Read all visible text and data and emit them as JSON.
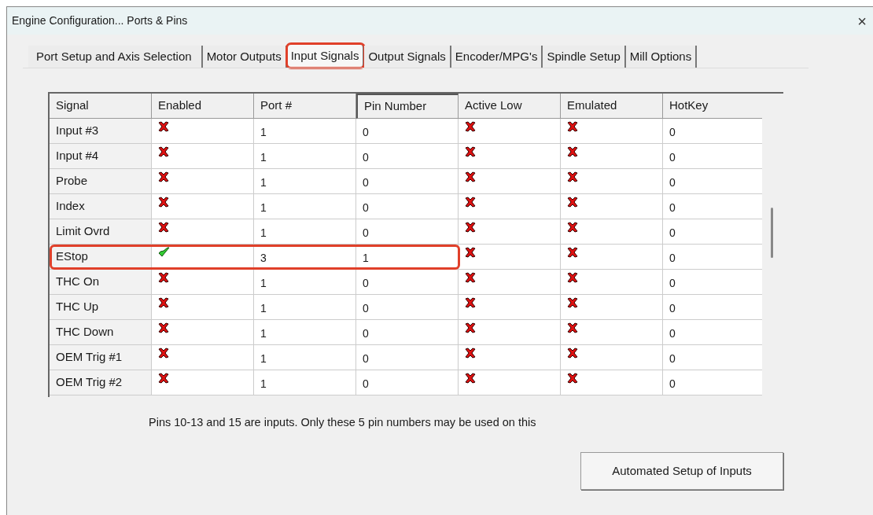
{
  "window": {
    "title": "Engine Configuration... Ports & Pins",
    "close": "×"
  },
  "tabs": [
    {
      "label": "Port Setup and Axis Selection",
      "selected": false,
      "annotated": false
    },
    {
      "label": "Motor Outputs",
      "selected": false,
      "annotated": false
    },
    {
      "label": "Input Signals",
      "selected": true,
      "annotated": true
    },
    {
      "label": "Output Signals",
      "selected": false,
      "annotated": false
    },
    {
      "label": "Encoder/MPG's",
      "selected": false,
      "annotated": false
    },
    {
      "label": "Spindle Setup",
      "selected": false,
      "annotated": false
    },
    {
      "label": "Mill Options",
      "selected": false,
      "annotated": false
    }
  ],
  "table": {
    "columns": [
      "Signal",
      "Enabled",
      "Port #",
      "Pin Number",
      "Active Low",
      "Emulated",
      "HotKey"
    ],
    "rows": [
      {
        "signal": "Input #3",
        "enabled": false,
        "port": "1",
        "pin": "0",
        "active_low": false,
        "emulated": false,
        "hotkey": "0",
        "annotated": false
      },
      {
        "signal": "Input #4",
        "enabled": false,
        "port": "1",
        "pin": "0",
        "active_low": false,
        "emulated": false,
        "hotkey": "0",
        "annotated": false
      },
      {
        "signal": "Probe",
        "enabled": false,
        "port": "1",
        "pin": "0",
        "active_low": false,
        "emulated": false,
        "hotkey": "0",
        "annotated": false
      },
      {
        "signal": "Index",
        "enabled": false,
        "port": "1",
        "pin": "0",
        "active_low": false,
        "emulated": false,
        "hotkey": "0",
        "annotated": false
      },
      {
        "signal": "Limit Ovrd",
        "enabled": false,
        "port": "1",
        "pin": "0",
        "active_low": false,
        "emulated": false,
        "hotkey": "0",
        "annotated": false
      },
      {
        "signal": "EStop",
        "enabled": true,
        "port": "3",
        "pin": "1",
        "active_low": false,
        "emulated": false,
        "hotkey": "0",
        "annotated": true
      },
      {
        "signal": "THC On",
        "enabled": false,
        "port": "1",
        "pin": "0",
        "active_low": false,
        "emulated": false,
        "hotkey": "0",
        "annotated": false
      },
      {
        "signal": "THC Up",
        "enabled": false,
        "port": "1",
        "pin": "0",
        "active_low": false,
        "emulated": false,
        "hotkey": "0",
        "annotated": false
      },
      {
        "signal": "THC Down",
        "enabled": false,
        "port": "1",
        "pin": "0",
        "active_low": false,
        "emulated": false,
        "hotkey": "0",
        "annotated": false
      },
      {
        "signal": "OEM Trig #1",
        "enabled": false,
        "port": "1",
        "pin": "0",
        "active_low": false,
        "emulated": false,
        "hotkey": "0",
        "annotated": false
      },
      {
        "signal": "OEM Trig #2",
        "enabled": false,
        "port": "1",
        "pin": "0",
        "active_low": false,
        "emulated": false,
        "hotkey": "0",
        "annotated": false
      }
    ]
  },
  "note": "Pins 10-13 and 15 are inputs. Only these 5 pin numbers may be used on this",
  "button": "Automated Setup of Inputs"
}
